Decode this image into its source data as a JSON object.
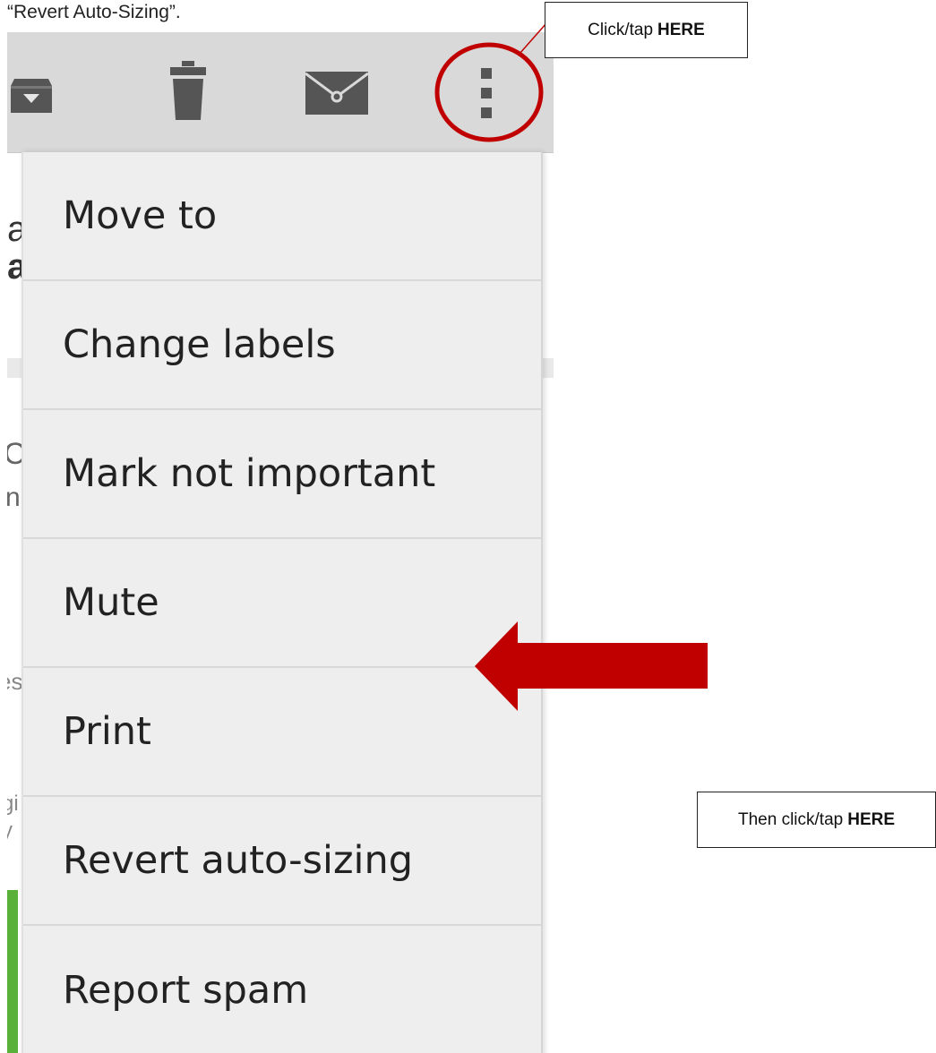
{
  "intro": {
    "text": "“Revert Auto-Sizing”."
  },
  "toolbar": {
    "icons": [
      "archive-icon",
      "trash-icon",
      "mail-icon",
      "overflow-menu-icon"
    ]
  },
  "background_fragments": [
    "a",
    "a",
    "C",
    "n",
    "es",
    "gi",
    "y"
  ],
  "menu": {
    "items": [
      {
        "label": "Move to"
      },
      {
        "label": "Change labels"
      },
      {
        "label": "Mark not important"
      },
      {
        "label": "Mute"
      },
      {
        "label": "Print"
      },
      {
        "label": "Revert auto-sizing"
      },
      {
        "label": "Report spam"
      }
    ]
  },
  "annotations": {
    "callout_1": {
      "prefix": "Click/tap",
      "emphasis": "HERE"
    },
    "callout_2": {
      "prefix": "Then click/tap",
      "emphasis": "HERE"
    },
    "highlight_color": "#c00000",
    "arrow_color": "#c00000"
  },
  "colors": {
    "toolbar_bg": "#d9d9d9",
    "icon": "#555555",
    "menu_bg": "#eeeeee",
    "menu_text": "#222222",
    "accent_green": "#59b13a"
  }
}
